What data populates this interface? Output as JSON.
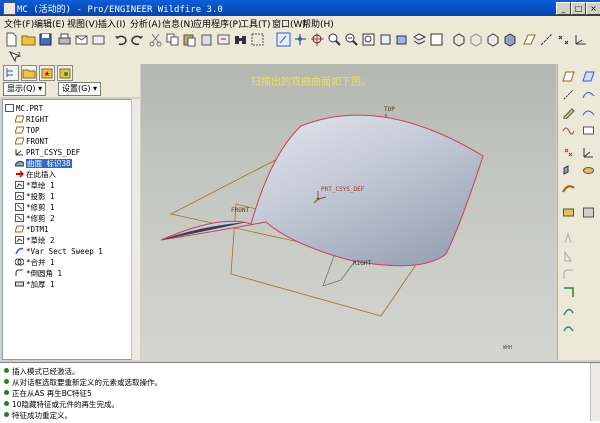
{
  "window": {
    "title": "MC (活动的) - Pro/ENGINEER Wildfire 3.0",
    "minimize": "_",
    "maximize": "□",
    "close": "×"
  },
  "menu": [
    "文件(F)",
    "编辑(E)",
    "视图(V)",
    "插入(I)",
    "分析(A)",
    "信息(N)",
    "应用程序(P)",
    "工具(T)",
    "窗口(W)",
    "帮助(H)"
  ],
  "navigator": {
    "show_label": "显示(Q) ▾",
    "settings_label": "设置(G) ▾"
  },
  "model_tree": [
    {
      "label": "MC.PRT",
      "icon": "part-icon",
      "indent": 0
    },
    {
      "label": "RIGHT",
      "icon": "datum-plane-icon",
      "indent": 1
    },
    {
      "label": "TOP",
      "icon": "datum-plane-icon",
      "indent": 1
    },
    {
      "label": "FRONT",
      "icon": "datum-plane-icon",
      "indent": 1
    },
    {
      "label": "PRT_CSYS_DEF",
      "icon": "csys-icon",
      "indent": 1
    },
    {
      "label": "曲面 标识38",
      "icon": "surface-icon",
      "indent": 1,
      "selected": true
    },
    {
      "label": "在此插入",
      "icon": "insert-here-icon",
      "indent": 1
    },
    {
      "label": "*草绘 1",
      "icon": "sketch-icon",
      "indent": 1
    },
    {
      "label": "*投影 1",
      "icon": "projection-icon",
      "indent": 1
    },
    {
      "label": "*修剪 1",
      "icon": "trim-icon",
      "indent": 1
    },
    {
      "label": "*修剪 2",
      "icon": "trim-icon",
      "indent": 1
    },
    {
      "label": "*DTM1",
      "icon": "datum-plane-icon",
      "indent": 1
    },
    {
      "label": "*草绘 2",
      "icon": "sketch-icon",
      "indent": 1
    },
    {
      "label": "*Var Sect Sweep 1",
      "icon": "sweep-icon",
      "indent": 1
    },
    {
      "label": "*合并 1",
      "icon": "merge-icon",
      "indent": 1
    },
    {
      "label": "*倒圆角 1",
      "icon": "round-icon",
      "indent": 1
    },
    {
      "label": "*加厚 1",
      "icon": "thicken-icon",
      "indent": 1
    }
  ],
  "viewport": {
    "message": "扫描出的双曲曲面如下图。",
    "labels": {
      "top": "TOP",
      "csys": "PRT_CSYS_DEF",
      "front": "FRONT",
      "right": "RIGHT",
      "watermark": "WHH"
    }
  },
  "messages": [
    "插入模式已经激活。",
    "从对话框选取要重新定义的元素或选取操作。",
    "正在从AS 再生BC特征5",
    "10隐藏特征或元件的再生完成。",
    "特征成功重定义。"
  ],
  "colors": {
    "accent": "#0a5fd8",
    "surface_edge": "#d23a5a",
    "datum": "#b07020",
    "message_text": "#e8e25a"
  }
}
